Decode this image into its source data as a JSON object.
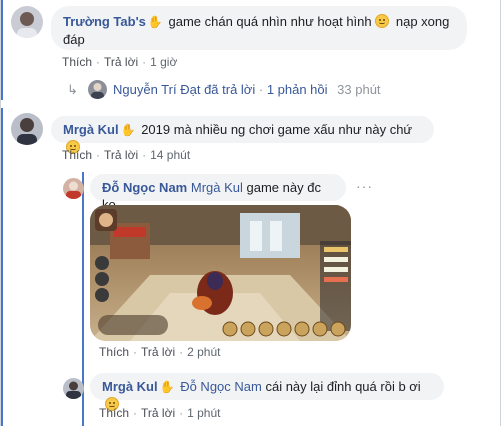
{
  "comments": [
    {
      "author": "Trường Tab's",
      "hand": "✋",
      "text_line1": "game chán quá nhìn như hoạt hình",
      "text_line2": "nạp xong đáp",
      "like": "Thích",
      "reply": "Trả lời",
      "time": "1 giờ",
      "reply_summary": {
        "replier": "Nguyễn Trí Đạt",
        "action": "đã trả lời",
        "count": "1 phản hồi",
        "time": "33 phút"
      }
    },
    {
      "author": "Mrgà Kul",
      "hand": "✋",
      "text": "2019 mà nhiều ng chơi game xấu như này chứ",
      "like": "Thích",
      "reply": "Trả lời",
      "time": "14 phút",
      "replies": [
        {
          "author": "Đỗ Ngọc Nam",
          "mention": "Mrgà Kul",
          "text": "game này đc ko",
          "more": "···",
          "like": "Thích",
          "reply": "Trả lời",
          "time": "2 phút"
        },
        {
          "author": "Mrgà Kul",
          "hand": "✋",
          "mention": "Đỗ Ngọc Nam",
          "text": "cái này lại đỉnh quá rồi b ơi",
          "like": "Thích",
          "reply": "Trả lời",
          "time": "1 phút"
        }
      ]
    }
  ],
  "separator": "·",
  "colors": {
    "author": "#385898",
    "bubble": "#f2f3f5",
    "accent": "#4a76c9",
    "muted": "#90949c"
  }
}
